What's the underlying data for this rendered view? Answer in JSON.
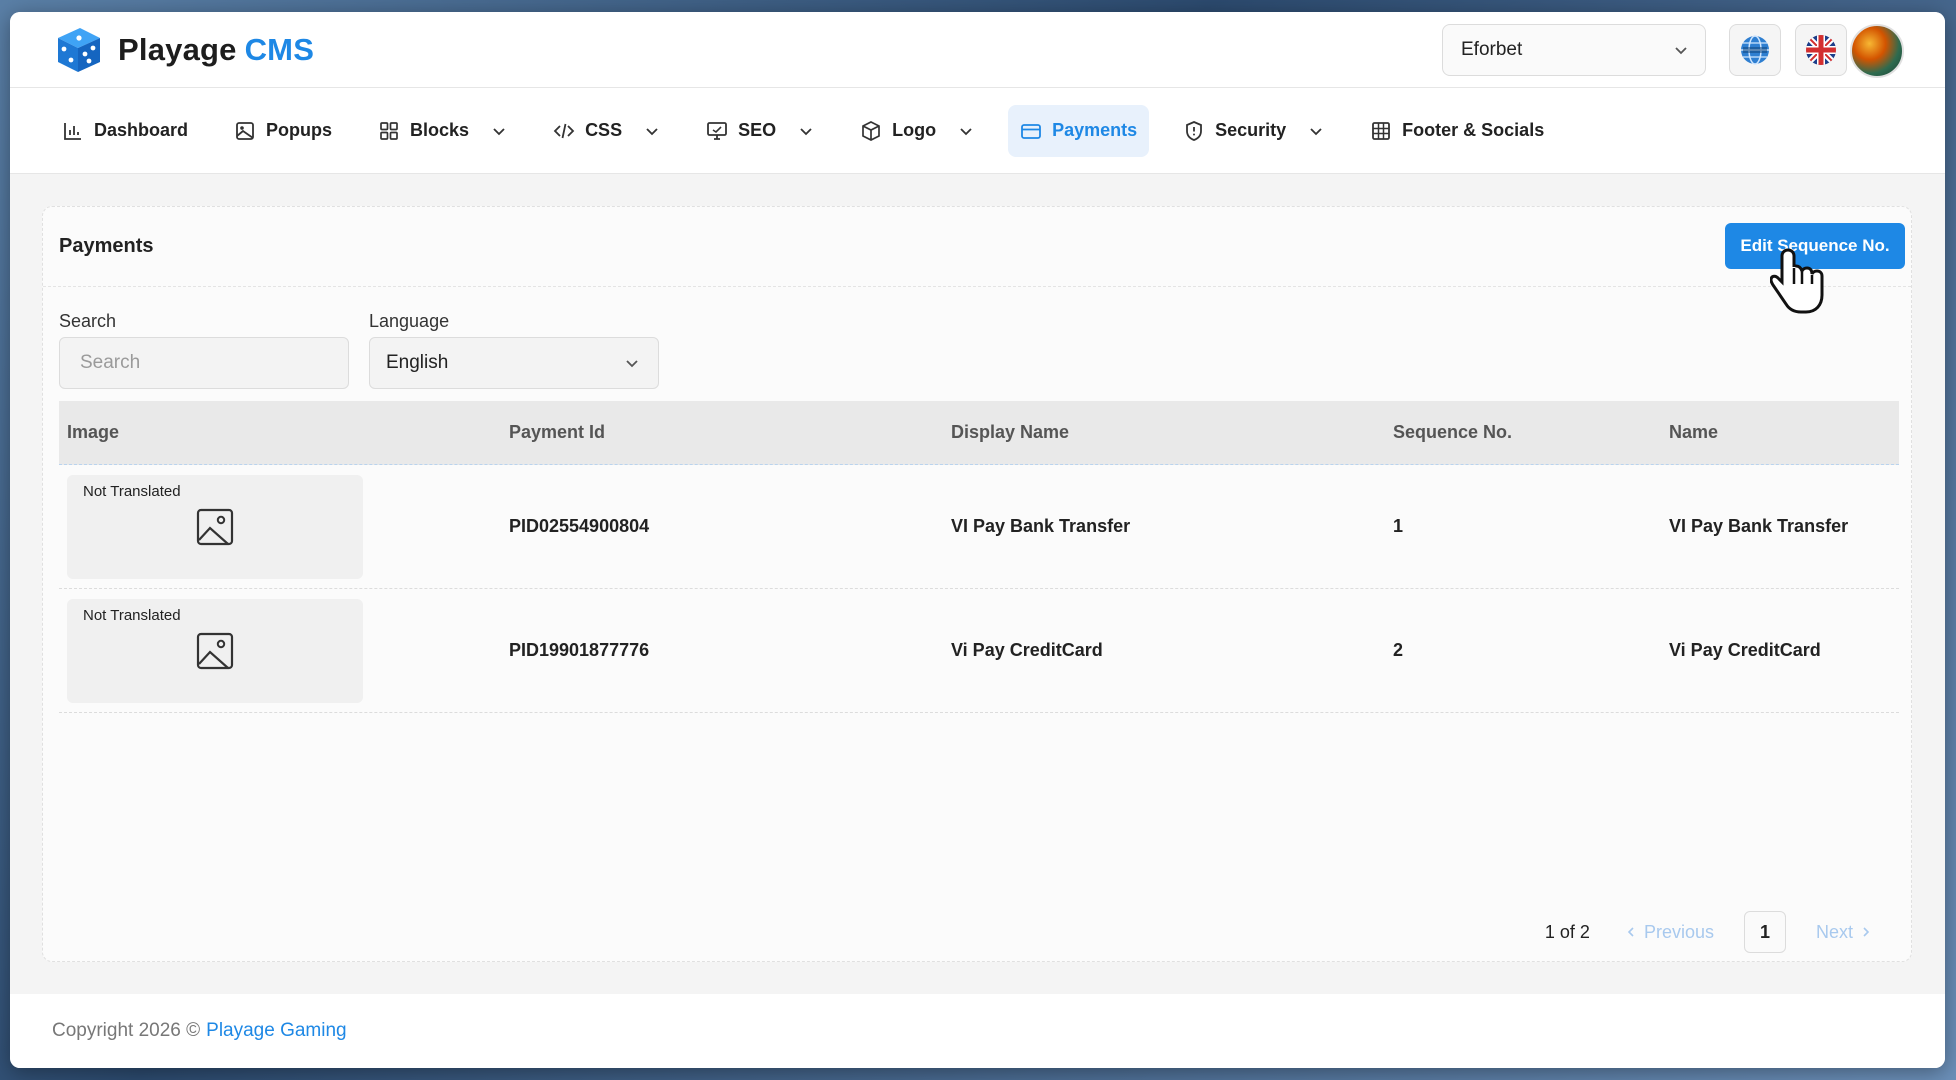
{
  "app": {
    "logo_primary": "Playage",
    "logo_secondary": "CMS",
    "site_selector": "Eforbet"
  },
  "nav": [
    {
      "label": "Dashboard",
      "icon": "bar-chart-icon",
      "dropdown": false,
      "active": false
    },
    {
      "label": "Popups",
      "icon": "image-icon",
      "dropdown": false,
      "active": false
    },
    {
      "label": "Blocks",
      "icon": "grid-icon",
      "dropdown": true,
      "active": false
    },
    {
      "label": "CSS",
      "icon": "code-icon",
      "dropdown": true,
      "active": false
    },
    {
      "label": "SEO",
      "icon": "monitor-icon",
      "dropdown": true,
      "active": false
    },
    {
      "label": "Logo",
      "icon": "box-icon",
      "dropdown": true,
      "active": false
    },
    {
      "label": "Payments",
      "icon": "credit-card-icon",
      "dropdown": false,
      "active": true
    },
    {
      "label": "Security",
      "icon": "shield-icon",
      "dropdown": true,
      "active": false
    },
    {
      "label": "Footer & Socials",
      "icon": "table-icon",
      "dropdown": false,
      "active": false
    }
  ],
  "card": {
    "title": "Payments",
    "edit_button": "Edit Sequence No."
  },
  "filters": {
    "search_label": "Search",
    "search_placeholder": "Search",
    "language_label": "Language",
    "language_value": "English"
  },
  "table": {
    "headers": [
      "Image",
      "Payment Id",
      "Display Name",
      "Sequence No.",
      "Name"
    ],
    "rows": [
      {
        "image_tag": "Not Translated",
        "payment_id": "PID02554900804",
        "display_name": "VI Pay Bank Transfer",
        "sequence": "1",
        "name": "VI Pay Bank Transfer"
      },
      {
        "image_tag": "Not Translated",
        "payment_id": "PID19901877776",
        "display_name": "Vi Pay CreditCard",
        "sequence": "2",
        "name": "Vi Pay CreditCard"
      }
    ]
  },
  "pagination": {
    "info": "1 of 2",
    "previous": "Previous",
    "current": "1",
    "next": "Next"
  },
  "footer": {
    "copyright": "Copyright 2026 ©",
    "brand": "Playage Gaming"
  },
  "colors": {
    "accent": "#1e88e5",
    "active_nav_bg": "#e8f1fc"
  }
}
